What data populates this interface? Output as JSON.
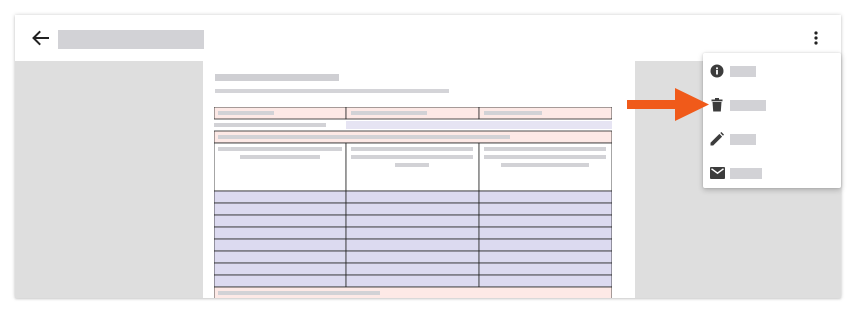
{
  "header": {
    "title": "",
    "back_icon": "arrow-left-icon",
    "more_icon": "more-vert-icon"
  },
  "document": {
    "page_title": "",
    "page_subtitle": ""
  },
  "menu": {
    "items": [
      {
        "id": "info",
        "icon": "info-icon",
        "label": ""
      },
      {
        "id": "delete",
        "icon": "trash-icon",
        "label": ""
      },
      {
        "id": "edit",
        "icon": "pencil-icon",
        "label": ""
      },
      {
        "id": "email",
        "icon": "email-icon",
        "label": ""
      }
    ]
  },
  "colors": {
    "placeholder": "#d2d2d6",
    "viewer_bg": "#dedede",
    "highlight_arrow": "#f05a1a",
    "table_pink": "#fde9e6",
    "table_lavender": "#dcdaf0",
    "icon": "#3c3c3c"
  }
}
